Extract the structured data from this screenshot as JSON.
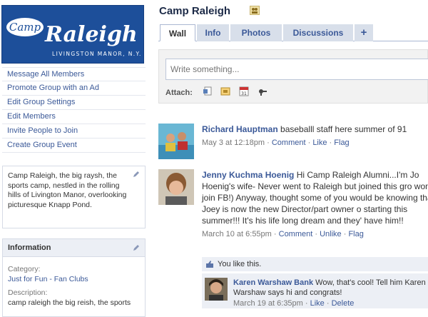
{
  "logo": {
    "line1": "Camp",
    "line2": "Raleigh",
    "tagline": "LIVINGSTON MANOR, N.Y."
  },
  "sidebar": {
    "actions": [
      "Message All Members",
      "Promote Group with an Ad",
      "Edit Group Settings",
      "Edit Members",
      "Invite People to Join",
      "Create Group Event"
    ],
    "description": "Camp Raleigh, the big raysh, the sports camp, nestled in the rolling hills of Livington Manor, overlooking picturesque Knapp Pond.",
    "info": {
      "title": "Information",
      "category_label": "Category:",
      "category_value": "Just for Fun - Fan Clubs",
      "description_label": "Description:",
      "description_value": "camp raleigh the big reish, the sports"
    }
  },
  "page": {
    "title": "Camp Raleigh"
  },
  "tabs": [
    {
      "label": "Wall",
      "active": true
    },
    {
      "label": "Info",
      "active": false
    },
    {
      "label": "Photos",
      "active": false
    },
    {
      "label": "Discussions",
      "active": false
    },
    {
      "label": "+",
      "active": false
    }
  ],
  "composer": {
    "placeholder": "Write something...",
    "attach_label": "Attach:"
  },
  "posts": [
    {
      "author": "Richard Hauptman",
      "text": "baseballl staff here summer of 91",
      "time": "May 3 at 12:18pm",
      "sep": " · ",
      "actions": [
        "Comment",
        "Like",
        "Flag"
      ]
    },
    {
      "author": "Jenny Kuchma Hoenig",
      "text": "Hi Camp Raleigh Alumni...I'm Jo Hoenig's wife- Never went to Raleigh but joined this gro won't join FB!) Anyway, thought some of you would be knowing that Joey is now the new Director/part owner o starting this summer!!! It's his life long dream and they' have him!!",
      "time": "March 10 at 6:55pm",
      "sep": " · ",
      "actions": [
        "Comment",
        "Unlike",
        "Flag"
      ],
      "likes_text": "You like this.",
      "comment": {
        "author": "Karen Warshaw Bank",
        "text": "Wow, that's cool! Tell him Karen Warshaw says hi and congrats!",
        "time": "March 19 at 6:35pm",
        "actions": [
          "Like",
          "Delete"
        ]
      }
    }
  ],
  "colors": {
    "link": "#3b5998",
    "logo_bg": "#1d4f9a",
    "tab_bg": "#d8dfea",
    "panel_bg": "#eceff5"
  }
}
